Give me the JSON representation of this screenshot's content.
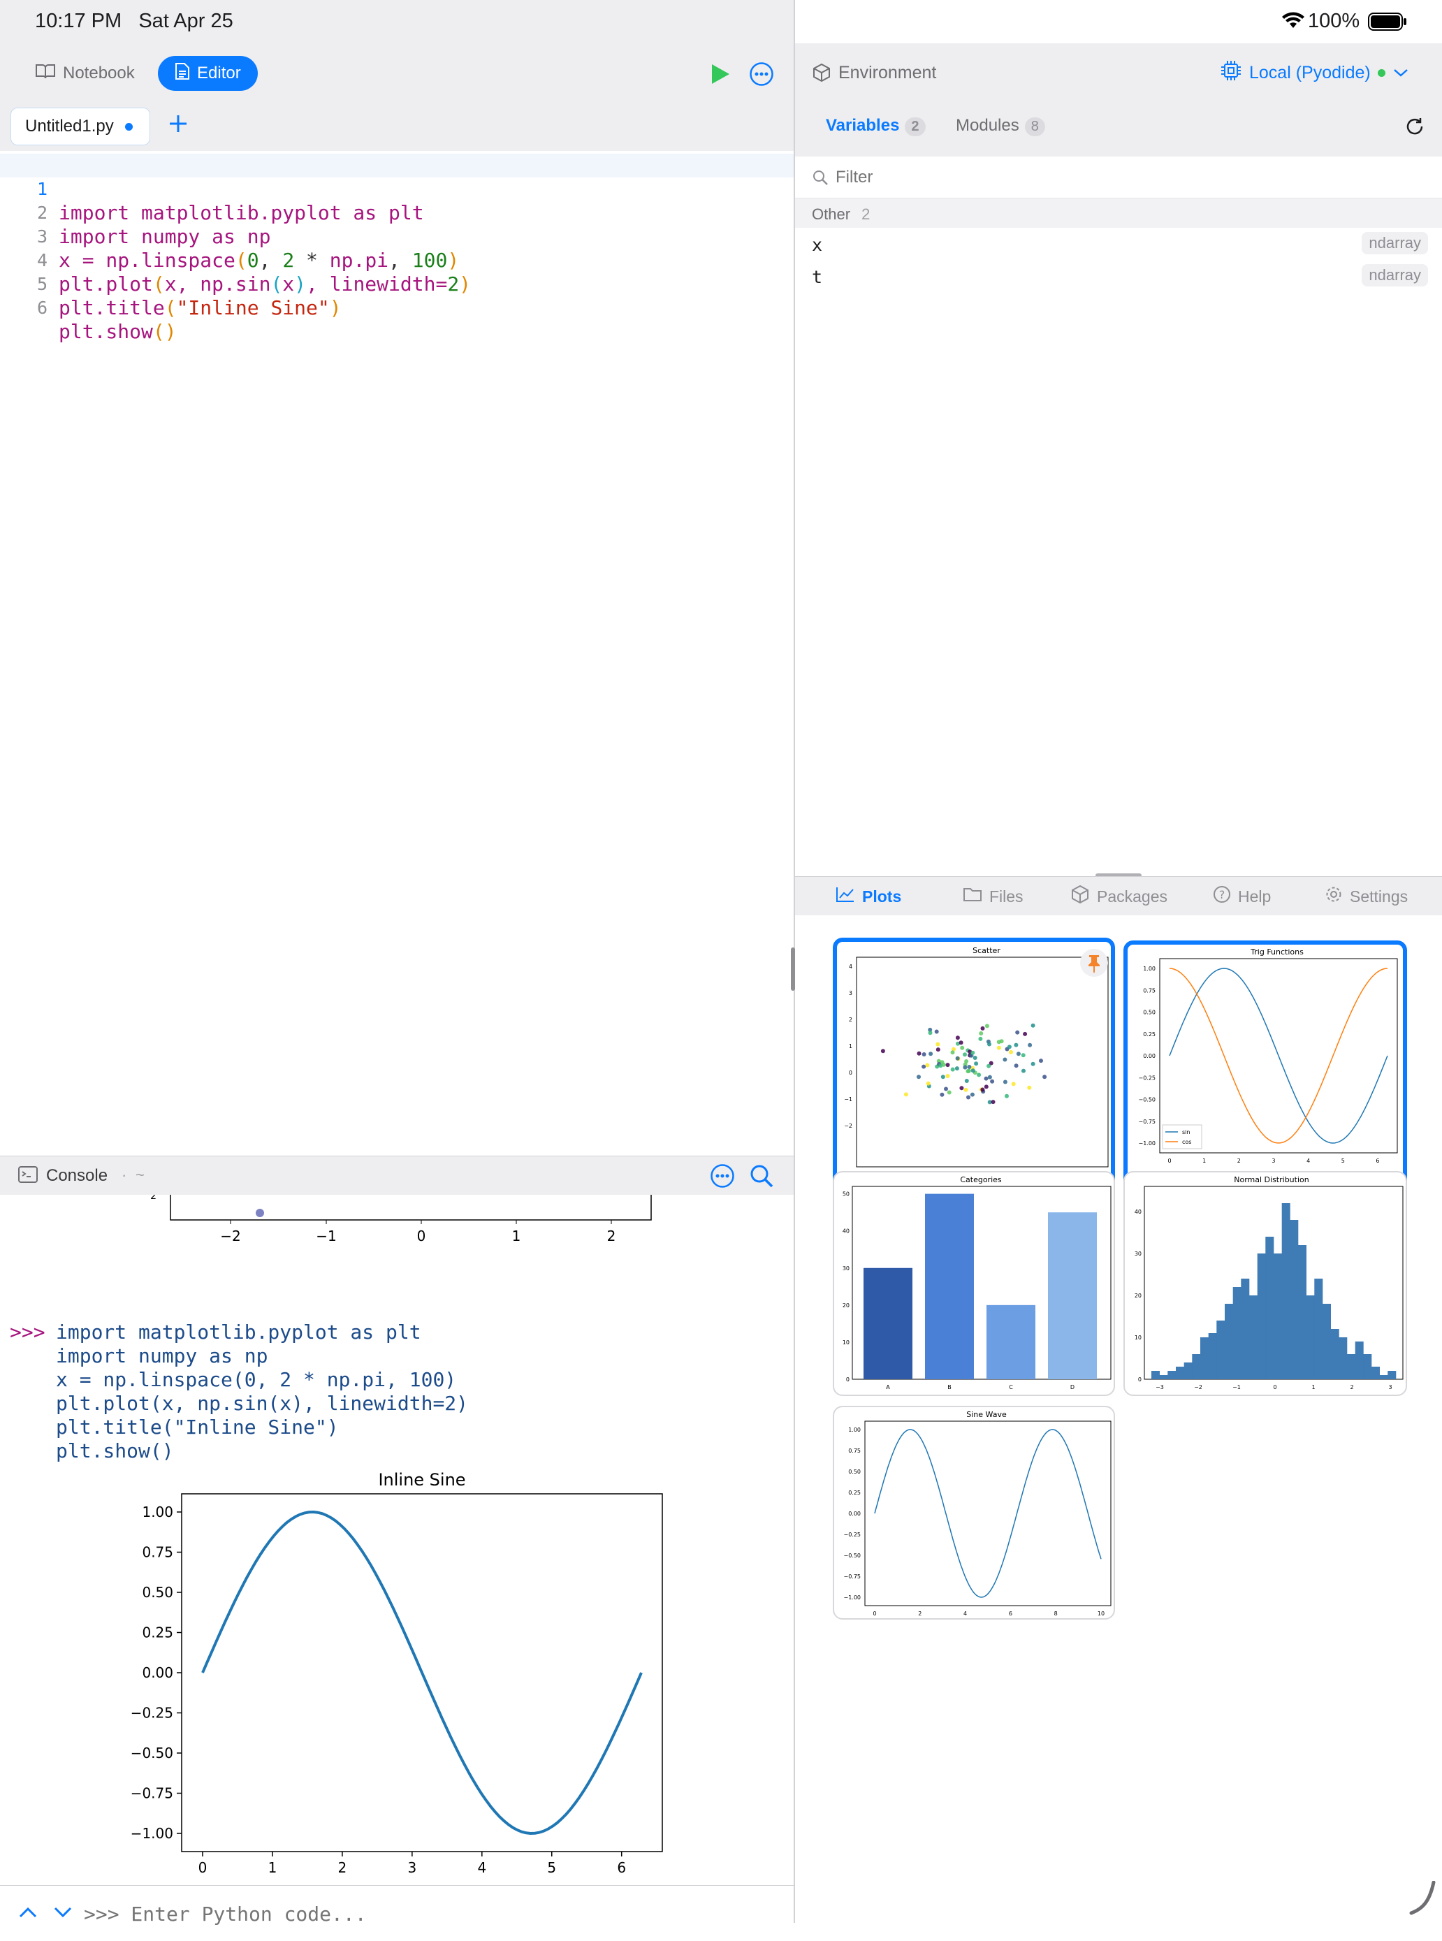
{
  "status": {
    "time": "10:17 PM",
    "date": "Sat Apr 25",
    "battery": "100%"
  },
  "left_toolbar": {
    "notebook_label": "Notebook",
    "editor_label": "Editor"
  },
  "file_tab": {
    "name": "Untitled1.py"
  },
  "editor": {
    "lines": [
      {
        "n": "1",
        "code": "import matplotlib.pyplot as plt"
      },
      {
        "n": "2",
        "code": "import numpy as np"
      },
      {
        "n": "3",
        "code": "x = np.linspace(0, 2 * np.pi, 100)"
      },
      {
        "n": "4",
        "code": "plt.plot(x, np.sin(x), linewidth=2)"
      },
      {
        "n": "5",
        "code": "plt.title(\"Inline Sine\")"
      },
      {
        "n": "6",
        "code": "plt.show()"
      }
    ]
  },
  "console": {
    "title": "Console",
    "path": "~",
    "prompt": ">>>",
    "history": [
      "import matplotlib.pyplot as plt",
      "import numpy as np",
      "x = np.linspace(0, 2 * np.pi, 100)",
      "plt.plot(x, np.sin(x), linewidth=2)",
      "plt.title(\"Inline Sine\")",
      "plt.show()"
    ],
    "prev_plot_ticks": [
      "−2",
      "−1",
      "0",
      "1",
      "2"
    ],
    "input_placeholder": ">>> Enter Python code..."
  },
  "chart_data": {
    "type": "line",
    "title": "Inline Sine",
    "xlabel": "",
    "ylabel": "",
    "xlim": [
      0,
      6.283
    ],
    "ylim": [
      -1.0,
      1.0
    ],
    "x_ticks": [
      "0",
      "1",
      "2",
      "3",
      "4",
      "5",
      "6"
    ],
    "y_ticks": [
      "1.00",
      "0.75",
      "0.50",
      "0.25",
      "0.00",
      "−0.25",
      "−0.50",
      "−0.75",
      "−1.00"
    ],
    "series": [
      {
        "function": "sin(x)",
        "x_start": 0,
        "x_end": 6.283,
        "points": 100,
        "color": "#1f77b4"
      }
    ]
  },
  "right_toolbar": {
    "environment_label": "Environment",
    "runtime_label": "Local (Pyodide)"
  },
  "inspector": {
    "variables_label": "Variables",
    "variables_count": "2",
    "modules_label": "Modules",
    "modules_count": "8",
    "filter_placeholder": "Filter",
    "group_label": "Other",
    "group_count": "2",
    "vars": [
      {
        "name": "x",
        "type": "ndarray"
      },
      {
        "name": "t",
        "type": "ndarray"
      }
    ]
  },
  "bottom_tabs": {
    "plots": "Plots",
    "files": "Files",
    "packages": "Packages",
    "help": "Help",
    "settings": "Settings"
  },
  "plots": {
    "scatter_title": "Scatter",
    "trig_title": "Trig Functions",
    "trig_legend": [
      "sin",
      "cos"
    ],
    "categories_title": "Categories",
    "categories": [
      "A",
      "B",
      "C",
      "D"
    ],
    "category_values": [
      30,
      50,
      20,
      45
    ],
    "normal_title": "Normal Distribution",
    "sine_title": "Sine Wave"
  },
  "colors": {
    "accent": "#0a7aff",
    "run": "#34c759",
    "line_blue": "#1f77b4",
    "line_orange": "#ff7f0e",
    "pin": "#f5832a"
  }
}
